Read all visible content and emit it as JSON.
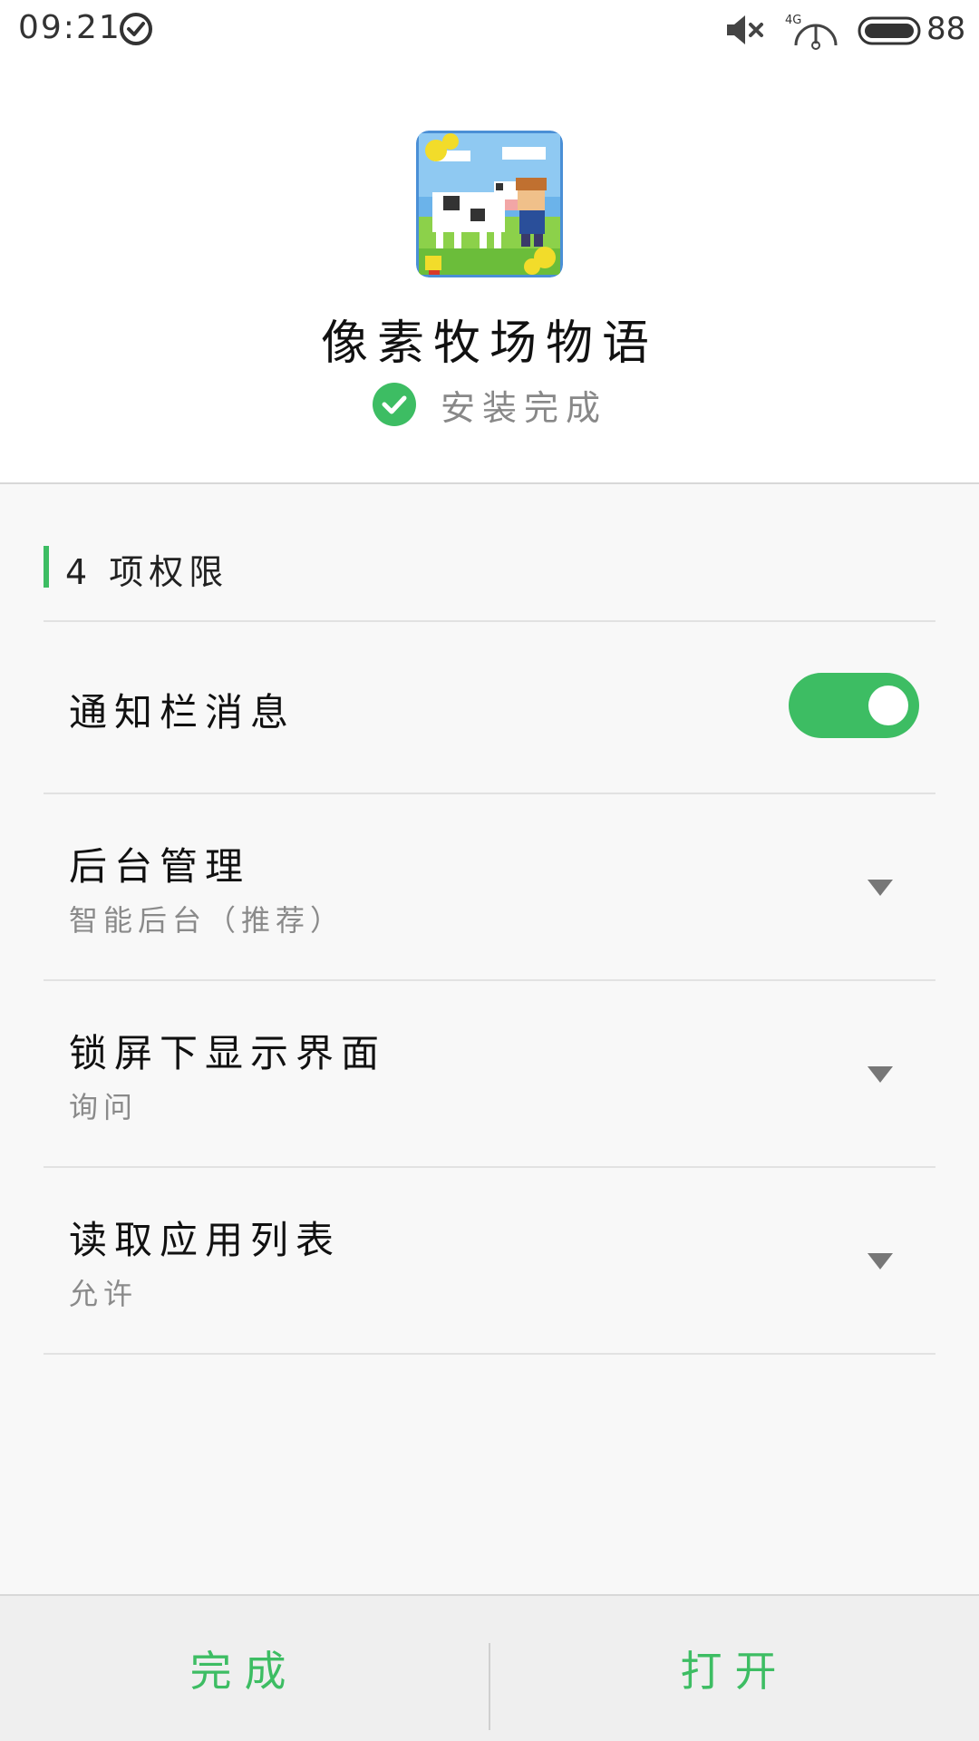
{
  "status_bar": {
    "time": "09:21",
    "network": "4G",
    "battery": "88",
    "icons": [
      "check-circle-icon",
      "mute-icon",
      "signal-icon",
      "battery-icon"
    ]
  },
  "app": {
    "name": "像素牧场物语",
    "install_status": "安装完成",
    "icon": "pixel-ranch-app-icon"
  },
  "permissions": {
    "title": "4 项权限",
    "items": [
      {
        "label": "通知栏消息",
        "control": "toggle",
        "enabled": true
      },
      {
        "label": "后台管理",
        "value": "智能后台（推荐）",
        "control": "dropdown"
      },
      {
        "label": "锁屏下显示界面",
        "value": "询问",
        "control": "dropdown"
      },
      {
        "label": "读取应用列表",
        "value": "允许",
        "control": "dropdown"
      }
    ]
  },
  "footer": {
    "done_label": "完成",
    "open_label": "打开"
  },
  "colors": {
    "accent": "#3dbd63",
    "divider": "#e2e2e2",
    "background": "#f8f8f8"
  }
}
